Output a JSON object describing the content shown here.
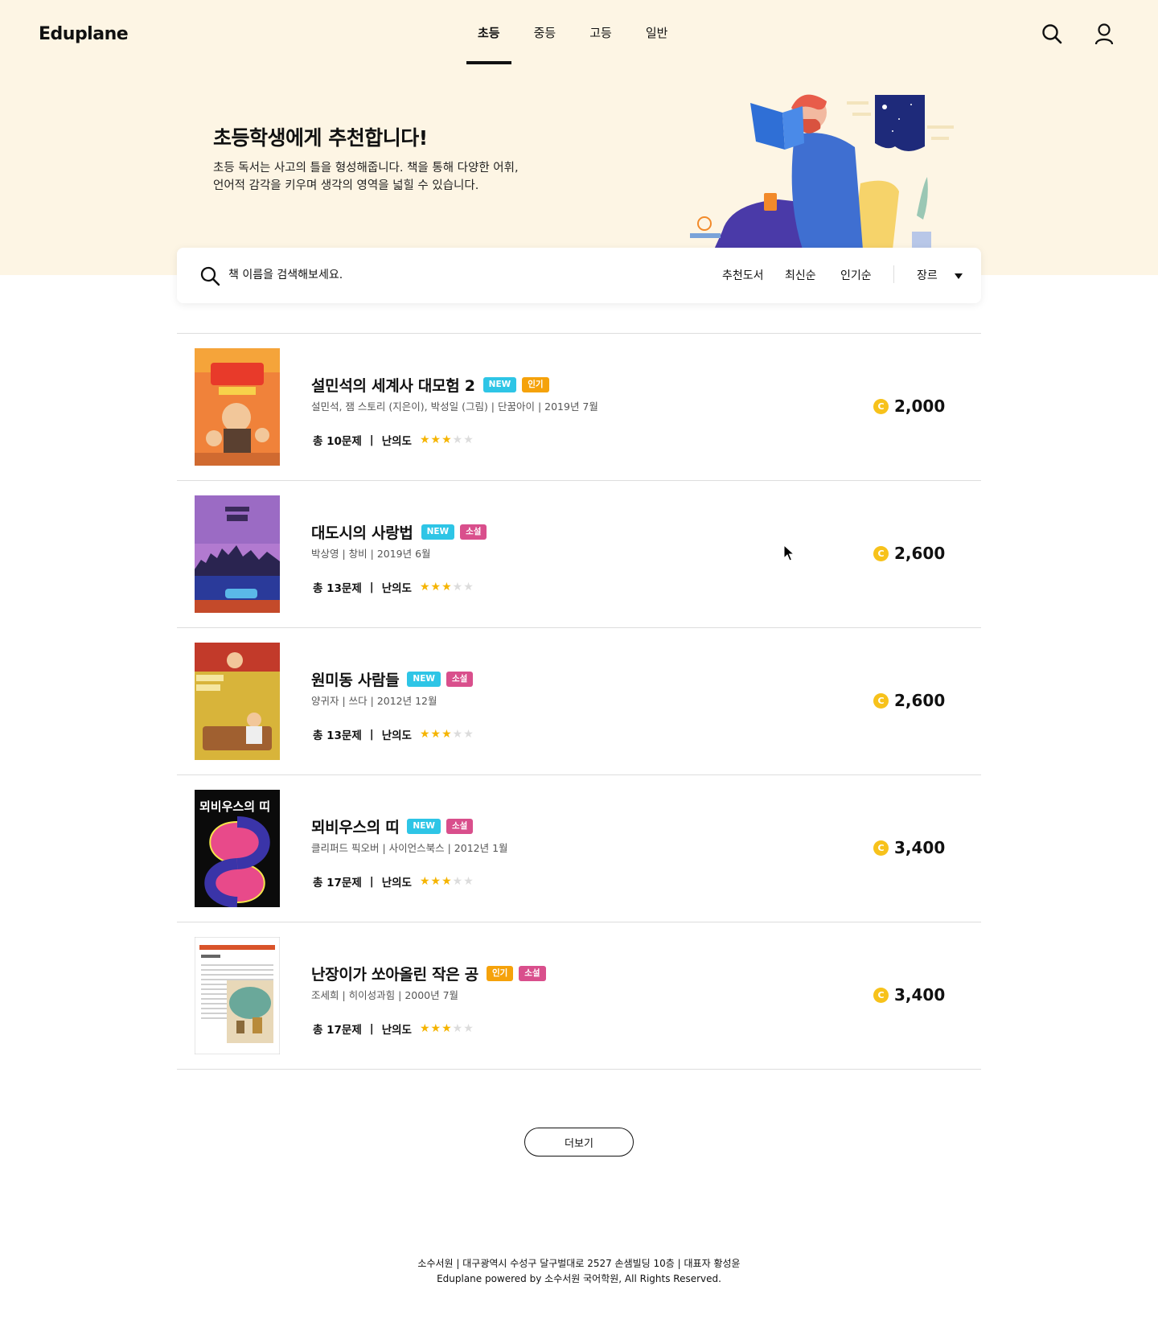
{
  "header": {
    "logo": "Eduplane",
    "nav": [
      {
        "label": "초등",
        "active": true
      },
      {
        "label": "중등",
        "active": false
      },
      {
        "label": "고등",
        "active": false
      },
      {
        "label": "일반",
        "active": false
      }
    ],
    "icons": [
      "search-icon",
      "user-icon"
    ]
  },
  "hero": {
    "title": "초등학생에게 추천합니다!",
    "desc_line1": "초등 독서는 사고의 틀을 형성해줍니다. 책을 통해 다양한 어휘,",
    "desc_line2": "언어적 감각을 키우며 생각의 영역을 넓힐  수 있습니다."
  },
  "search": {
    "placeholder": "책 이름을 검색해보세요.",
    "sort_options": [
      "추천도서",
      "최신순",
      "인기순"
    ],
    "genre_label": "장르"
  },
  "books": [
    {
      "title": "설민석의 세계사 대모험 2",
      "badges": [
        {
          "label": "NEW",
          "type": "new"
        },
        {
          "label": "인기",
          "type": "pop"
        }
      ],
      "meta": "설민석, 잼 스토리 (지은이), 박성일 (그림) | 단꿈아이 | 2019년 7월",
      "questions": "총 10문제",
      "difficulty_label": "난의도",
      "rating": 3,
      "price": "2,000"
    },
    {
      "title": "대도시의 사랑법",
      "badges": [
        {
          "label": "NEW",
          "type": "new"
        },
        {
          "label": "소설",
          "type": "novel"
        }
      ],
      "meta": "박상영 | 창비 | 2019년 6월",
      "questions": "총 13문제",
      "difficulty_label": "난의도",
      "rating": 3,
      "price": "2,600"
    },
    {
      "title": "원미동 사람들",
      "badges": [
        {
          "label": "NEW",
          "type": "new"
        },
        {
          "label": "소설",
          "type": "novel"
        }
      ],
      "meta": "양귀자 | 쓰다 | 2012년 12월",
      "questions": "총 13문제",
      "difficulty_label": "난의도",
      "rating": 3,
      "price": "2,600"
    },
    {
      "title": "뫼비우스의 띠",
      "badges": [
        {
          "label": "NEW",
          "type": "new"
        },
        {
          "label": "소설",
          "type": "novel"
        }
      ],
      "meta": "클리퍼드 픽오버 | 사이언스북스 | 2012년 1월",
      "questions": "총 17문제",
      "difficulty_label": "난의도",
      "rating": 3,
      "price": "3,400"
    },
    {
      "title": "난장이가 쏘아올린 작은 공",
      "badges": [
        {
          "label": "인기",
          "type": "pop"
        },
        {
          "label": "소설",
          "type": "novel"
        }
      ],
      "meta": "조세희 | 히이성과힘 | 2000년 7월",
      "questions": "총 17문제",
      "difficulty_label": "난의도",
      "rating": 3,
      "price": "3,400"
    }
  ],
  "stats_separator": "|",
  "coin_symbol": "C",
  "more_label": "더보기",
  "footer": {
    "line1": "소수서원 | 대구광역시 수성구 달구벌대로 2527 손샘빌딩 10층 | 대표자 황성윤",
    "line2": "Eduplane powered by 소수서원 국어학원, All Rights Reserved."
  },
  "colors": {
    "hero_bg": "#fdf5e4",
    "badge_new": "#2ec5e6",
    "badge_pop": "#f5a20b",
    "badge_novel": "#d94f8c",
    "star_on": "#f5b400",
    "coin": "#f7c21b"
  }
}
